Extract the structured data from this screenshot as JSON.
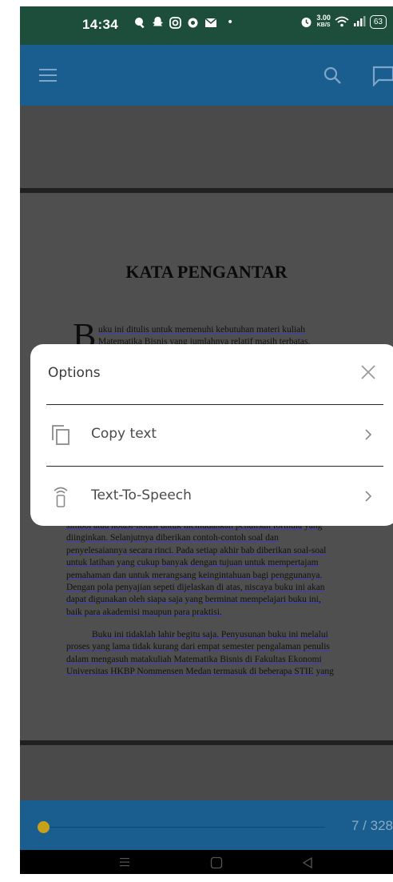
{
  "status_bar": {
    "time": "14:34",
    "net_speed_value": "3.00",
    "net_speed_unit": "KB/S",
    "battery": "63"
  },
  "app_bar": {
    "menu_icon": "hamburger-menu-icon",
    "search_icon": "search-icon",
    "comment_icon": "comment-icon",
    "icon_color": "#7fa6c8",
    "background": "#1a5d8f"
  },
  "document": {
    "title": "KATA PENGANTAR",
    "drop_cap": "B",
    "intro_lines": [
      "uku ini ditulis untuk memenuhi kebutuhan materi kuliah",
      "Matematika Bisnis yang jumlahnya relatif masih terbatas."
    ],
    "paragraph1_lines": [
      "simbol atau notasi-notasi untuk memudahkan penulisan formula yang",
      "diinginkan. Selanjutnya diberikan contoh-contoh soal dan",
      "penyelesaiannya secara rinci. Pada setiap akhir bab diberikan soal-soal",
      "untuk latihan yang cukup banyak dengan tujuan untuk mempertajam",
      "pemahaman dan untuk merangsang keingintahuan bagi penggunanya.",
      "Dengan pola penyajian sepeti dijelaskan di atas, niscaya buku ini akan",
      "dapat digunakan oleh siapa saja yang berminat mempelajari buku ini,",
      "baik para akademisi maupun para praktisi."
    ],
    "paragraph2_lines": [
      "Buku ini tidaklah lahir begitu saja. Penyusunan buku ini melalui",
      "proses yang lama tidak kurang dari empat semester pengalaman penulis",
      "dalam mengasuh matakuliah Matematika Bisnis di Fakultas Ekonomi",
      "Universitas HKBP Nommensen Medan termasuk di beberapa STIE yang"
    ]
  },
  "options_dialog": {
    "title": "Options",
    "close_icon": "close-icon",
    "items": [
      {
        "label": "Copy text",
        "icon": "copy-icon"
      },
      {
        "label": "Text-To-Speech",
        "icon": "text-to-speech-icon"
      }
    ]
  },
  "bottom_bar": {
    "page_indicator": "7 / 328",
    "progress_fraction": 0.021,
    "thumb_color": "#c7a117"
  },
  "nav_bar": {
    "recents_icon": "recents-icon",
    "home_icon": "home-icon",
    "back_icon": "back-icon"
  }
}
